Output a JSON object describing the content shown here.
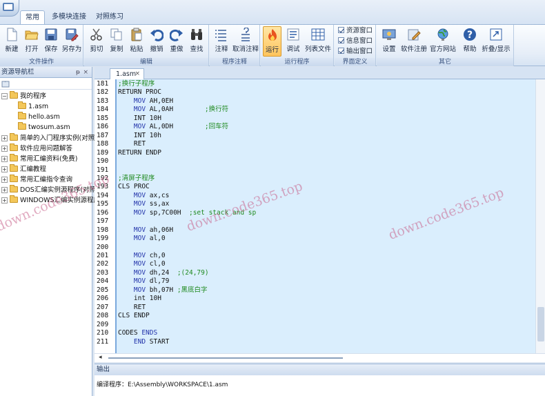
{
  "ribbon_tabs": [
    "常用",
    "多模块连接",
    "对照练习"
  ],
  "groups": {
    "file": {
      "label": "文件操作",
      "buttons": [
        "新建",
        "打开",
        "保存",
        "另存为"
      ]
    },
    "edit": {
      "label": "编辑",
      "buttons": [
        "剪切",
        "复制",
        "粘贴",
        "撤销",
        "重做",
        "查找"
      ]
    },
    "comment": {
      "label": "程序注释",
      "buttons": [
        "注释",
        "取消注释"
      ]
    },
    "run": {
      "label": "运行程序",
      "buttons": [
        "运行",
        "调试",
        "列表文件"
      ]
    },
    "view": {
      "label": "界面定义",
      "checks": [
        "资源窗口",
        "信息窗口",
        "输出窗口"
      ]
    },
    "other": {
      "label": "其它",
      "buttons": [
        "设置",
        "软件注册",
        "官方网站",
        "帮助",
        "折叠/显示"
      ]
    }
  },
  "left_panel": {
    "title": "资源导航栏",
    "pin": "ᵽ",
    "close": "×",
    "tree": [
      {
        "label": "我的程序",
        "type": "folder",
        "expanded": true
      },
      {
        "label": "1.asm",
        "type": "file"
      },
      {
        "label": "hello.asm",
        "type": "file"
      },
      {
        "label": "twosum.asm",
        "type": "file"
      },
      {
        "label": "简单的入门程序实例(对照练",
        "type": "folder"
      },
      {
        "label": "软件应用问题解答",
        "type": "folder"
      },
      {
        "label": "常用汇编资料(免费)",
        "type": "folder"
      },
      {
        "label": "汇编教程",
        "type": "folder"
      },
      {
        "label": "常用汇编指令查询",
        "type": "folder"
      },
      {
        "label": "DOS汇编实例源程序(对照练",
        "type": "folder"
      },
      {
        "label": "WINDOWS汇编实例源程序",
        "type": "folder"
      }
    ]
  },
  "editor": {
    "tab_name": "1.asm",
    "tab_close": "×",
    "lines": [
      {
        "n": "181",
        "segs": [
          {
            "t": ";换行子程序",
            "c": "cm"
          }
        ]
      },
      {
        "n": "182",
        "segs": [
          {
            "t": "RETURN PROC",
            "c": ""
          }
        ]
      },
      {
        "n": "183",
        "segs": [
          {
            "t": "    MOV ",
            "c": "kw"
          },
          {
            "t": "AH,0EH",
            "c": ""
          }
        ]
      },
      {
        "n": "184",
        "segs": [
          {
            "t": "    MOV ",
            "c": "kw"
          },
          {
            "t": "AL,0AH        ",
            "c": ""
          },
          {
            "t": ";换行符",
            "c": "cm"
          }
        ]
      },
      {
        "n": "185",
        "segs": [
          {
            "t": "    INT 10H",
            "c": ""
          }
        ]
      },
      {
        "n": "186",
        "segs": [
          {
            "t": "    MOV ",
            "c": "kw"
          },
          {
            "t": "AL,0DH        ",
            "c": ""
          },
          {
            "t": ";回车符",
            "c": "cm"
          }
        ]
      },
      {
        "n": "187",
        "segs": [
          {
            "t": "    INT 10h",
            "c": ""
          }
        ]
      },
      {
        "n": "188",
        "segs": [
          {
            "t": "    RET",
            "c": ""
          }
        ]
      },
      {
        "n": "189",
        "segs": [
          {
            "t": "RETURN ENDP",
            "c": ""
          }
        ]
      },
      {
        "n": "190",
        "segs": []
      },
      {
        "n": "191",
        "segs": []
      },
      {
        "n": "192",
        "segs": [
          {
            "t": ";清屏子程序",
            "c": "cm"
          }
        ]
      },
      {
        "n": "193",
        "segs": [
          {
            "t": "CLS PROC",
            "c": ""
          }
        ]
      },
      {
        "n": "194",
        "segs": [
          {
            "t": "    MOV ",
            "c": "kw"
          },
          {
            "t": "ax,cs",
            "c": ""
          }
        ]
      },
      {
        "n": "195",
        "segs": [
          {
            "t": "    MOV ",
            "c": "kw"
          },
          {
            "t": "ss,ax",
            "c": ""
          }
        ]
      },
      {
        "n": "196",
        "segs": [
          {
            "t": "    MOV ",
            "c": "kw"
          },
          {
            "t": "sp,7C00H  ",
            "c": ""
          },
          {
            "t": ";set stack and sp",
            "c": "cm"
          }
        ]
      },
      {
        "n": "197",
        "segs": []
      },
      {
        "n": "198",
        "segs": [
          {
            "t": "    MOV ",
            "c": "kw"
          },
          {
            "t": "ah,06H",
            "c": ""
          }
        ]
      },
      {
        "n": "199",
        "segs": [
          {
            "t": "    MOV ",
            "c": "kw"
          },
          {
            "t": "al,0",
            "c": ""
          }
        ]
      },
      {
        "n": "200",
        "segs": []
      },
      {
        "n": "201",
        "segs": [
          {
            "t": "    MOV ",
            "c": "kw"
          },
          {
            "t": "ch,0",
            "c": ""
          }
        ]
      },
      {
        "n": "202",
        "segs": [
          {
            "t": "    MOV ",
            "c": "kw"
          },
          {
            "t": "cl,0",
            "c": ""
          }
        ]
      },
      {
        "n": "203",
        "segs": [
          {
            "t": "    MOV ",
            "c": "kw"
          },
          {
            "t": "dh,24  ",
            "c": ""
          },
          {
            "t": ";(24,79)",
            "c": "cm"
          }
        ]
      },
      {
        "n": "204",
        "segs": [
          {
            "t": "    MOV ",
            "c": "kw"
          },
          {
            "t": "dl,79",
            "c": ""
          }
        ]
      },
      {
        "n": "205",
        "segs": [
          {
            "t": "    MOV ",
            "c": "kw"
          },
          {
            "t": "bh,07H ",
            "c": ""
          },
          {
            "t": ";黑底白字",
            "c": "cm"
          }
        ]
      },
      {
        "n": "206",
        "segs": [
          {
            "t": "    int 10H",
            "c": ""
          }
        ]
      },
      {
        "n": "207",
        "segs": [
          {
            "t": "    RET",
            "c": ""
          }
        ]
      },
      {
        "n": "208",
        "segs": [
          {
            "t": "CLS ENDP",
            "c": ""
          }
        ]
      },
      {
        "n": "209",
        "segs": []
      },
      {
        "n": "210",
        "segs": [
          {
            "t": "CODES ",
            "c": ""
          },
          {
            "t": "ENDS",
            "c": "kw"
          }
        ]
      },
      {
        "n": "211",
        "segs": [
          {
            "t": "    ",
            "c": ""
          },
          {
            "t": "END",
            "c": "kw"
          },
          {
            "t": " START",
            "c": ""
          }
        ]
      }
    ]
  },
  "output": {
    "title": "输出",
    "text": "编译程序：E:\\Assembly\\WORKSPACE\\1.asm"
  },
  "watermark": "down.code365.top"
}
